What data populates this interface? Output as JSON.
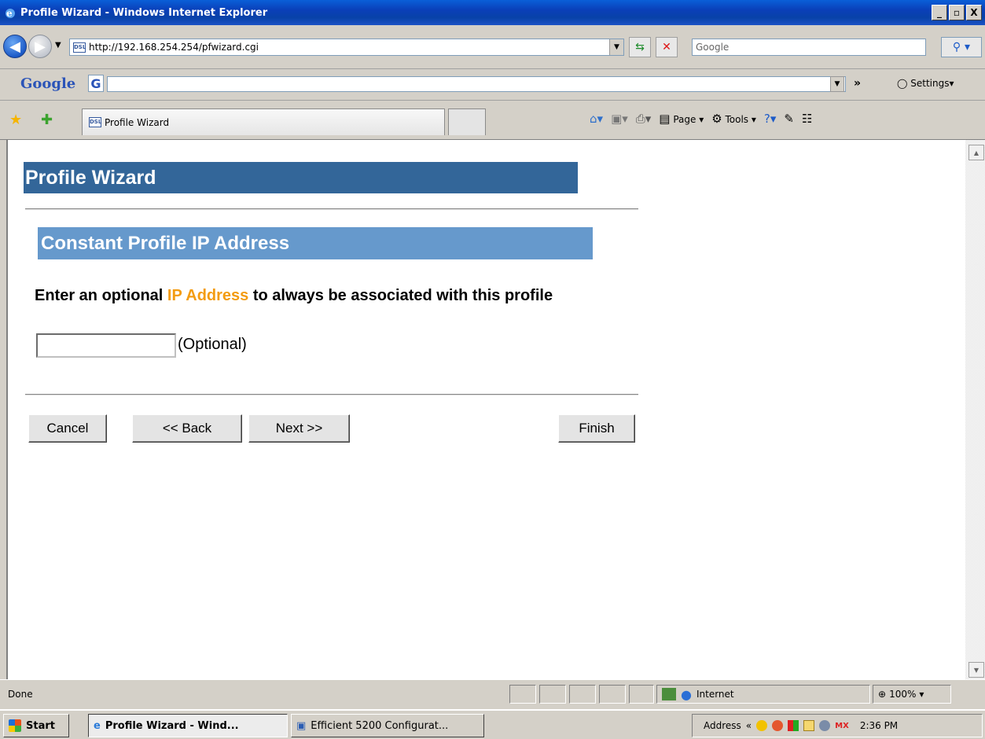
{
  "window": {
    "title": "Profile Wizard - Windows Internet Explorer",
    "min_label": "_",
    "max_label": "▫",
    "close_label": "X"
  },
  "address": {
    "url": "http://192.168.254.254/pfwizard.cgi",
    "site_icon_text": "DSL",
    "search_placeholder": "Google"
  },
  "google_toolbar": {
    "logo": "Google",
    "g_button": "G",
    "settings_label": "Settings"
  },
  "tabs": {
    "active_label": "Profile Wizard"
  },
  "command_bar": {
    "page_label": "Page",
    "tools_label": "Tools"
  },
  "page": {
    "title": "Profile Wizard",
    "section_title": "Constant Profile IP Address",
    "prompt_before": "Enter an optional ",
    "prompt_highlight": "IP Address",
    "prompt_after": " to always be associated with this profile",
    "ip_value": "",
    "optional_label": "(Optional)",
    "buttons": {
      "cancel": "Cancel",
      "back": "<< Back",
      "next": "Next >>",
      "finish": "Finish"
    },
    "highlight_color": "#f39c12",
    "title_bg": "#336699",
    "section_bg": "#6699cc"
  },
  "status": {
    "text": "Done",
    "zone": "Internet",
    "zoom": "100%"
  },
  "taskbar": {
    "start": "Start",
    "items": [
      "Profile Wizard - Wind...",
      "Efficient 5200 Configurat..."
    ],
    "tray_address": "Address",
    "tray_badge": "MX",
    "clock": "2:36 PM"
  }
}
